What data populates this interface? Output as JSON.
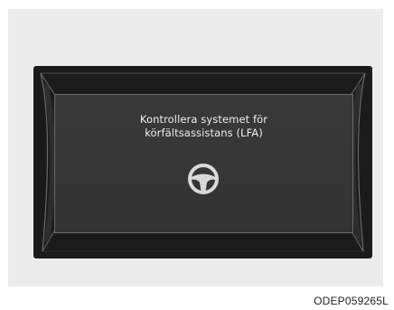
{
  "display": {
    "message_line1": "Kontrollera systemet för",
    "message_line2": "körfältsassistans (LFA)",
    "icon": "steering-wheel-icon"
  },
  "figure_code": "ODEP059265L",
  "colors": {
    "background": "#ececec",
    "bezel": "#1b1b1b",
    "screen": "#383838",
    "text": "#efefef"
  }
}
